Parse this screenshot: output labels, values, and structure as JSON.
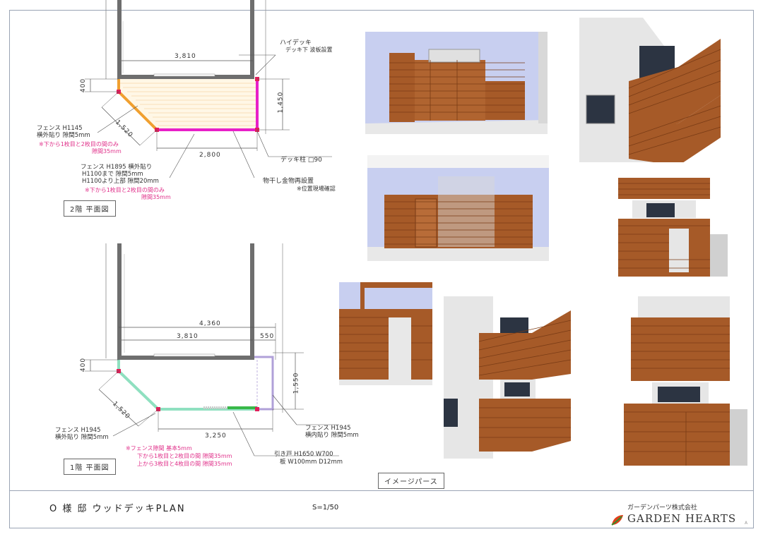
{
  "title_block": {
    "project": "O 様 邸 ウッドデッキPLAN",
    "scale": "S=1/50",
    "company_jp": "ガーデンパーツ株式会社",
    "company_en": "GARDEN HEARTS",
    "corner_mark": "A"
  },
  "floor2": {
    "caption": "2階 平面図",
    "dim_top": "3,810",
    "dim_left": "400",
    "dim_diag": "1,520",
    "dim_right": "1,450",
    "dim_bottom": "2,800",
    "high_deck": "ハイデッキ",
    "high_deck_sub": "デッキ下 波板設置",
    "post": "デッキ柱 □90",
    "laundry": "物干し金物再設置",
    "laundry_note": "※位置現場確認",
    "fence1_a": "フェンス H1145",
    "fence1_b": "横外貼り 隙間5mm",
    "fence1_note_a": "※下から1枚目と2枚目の間のみ",
    "fence1_note_b": "隙間35mm",
    "fence2_a": "フェンス H1895 横外貼り",
    "fence2_b": "H1100まで 隙間5mm",
    "fence2_c": "H1100より上部 隙間20mm",
    "fence2_note_a": "※下から1枚目と2枚目の間のみ",
    "fence2_note_b": "隙間35mm"
  },
  "floor1": {
    "caption": "1階 平面図",
    "dim_total": "4,360",
    "dim_top": "3,810",
    "dim_ext": "550",
    "dim_left": "400",
    "dim_diag": "1,520",
    "dim_right": "1,550",
    "dim_bottom": "3,250",
    "fence_l_a": "フェンス H1945",
    "fence_l_b": "横外貼り 隙間5mm",
    "fence_r_a": "フェンス H1945",
    "fence_r_b": "横内貼り 隙間5mm",
    "note_a": "※フェンス隙間 基本5mm",
    "note_b": "下から1枚目と2枚目の間 隙間35mm",
    "note_c": "上から3枚目と4枚目の間 隙間35mm",
    "door_a": "引き戸 H1650 W700",
    "door_b": "板 W100mm D12mm"
  },
  "image_perspective_label": "イメージパース",
  "colors": {
    "frame": "#9aa4b4",
    "wall": "#6e6e6e",
    "magenta": "#e820c8",
    "orange": "#f0a030",
    "mint": "#8fe0c0",
    "green": "#38b848",
    "wood": "#a65a28",
    "wood_dark": "#7a3c16",
    "sky": "#c8cff0"
  }
}
